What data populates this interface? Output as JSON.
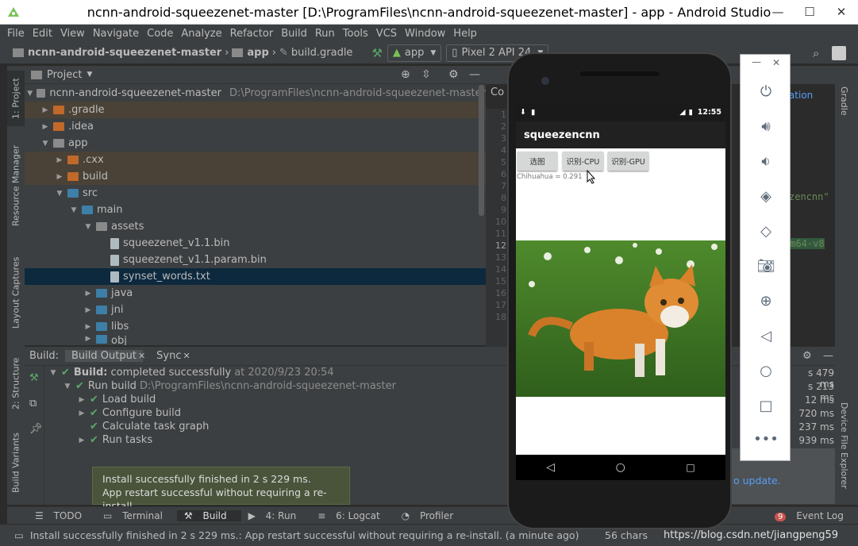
{
  "window": {
    "title": "ncnn-android-squeezenet-master [D:\\ProgramFiles\\ncnn-android-squeezenet-master] - app - Android Studio",
    "minimize": "—",
    "maximize": "☐",
    "close": "✕"
  },
  "menu": [
    "File",
    "Edit",
    "View",
    "Navigate",
    "Code",
    "Analyze",
    "Refactor",
    "Build",
    "Run",
    "Tools",
    "VCS",
    "Window",
    "Help"
  ],
  "nav": {
    "project": "ncnn-android-squeezenet-master",
    "module": "app",
    "file": "build.gradle",
    "run_config": "app",
    "device": "Pixel 2 API 24"
  },
  "left_tools": {
    "project": "1: Project",
    "resource": "Resource Manager",
    "layout": "Layout Captures",
    "structure": "2: Structure",
    "variants": "Build Variants"
  },
  "right_tools": {
    "gradle": "Gradle",
    "device_explorer": "Device File Explorer"
  },
  "project_panel": {
    "title": "Project",
    "tree": [
      {
        "label": "ncnn-android-squeezenet-master",
        "path": "D:\\ProgramFiles\\ncnn-android-squeezenet-master"
      },
      {
        "label": ".gradle"
      },
      {
        "label": ".idea"
      },
      {
        "label": "app"
      },
      {
        "label": ".cxx"
      },
      {
        "label": "build"
      },
      {
        "label": "src"
      },
      {
        "label": "main"
      },
      {
        "label": "assets"
      },
      {
        "label": "squeezenet_v1.1.bin"
      },
      {
        "label": "squeezenet_v1.1.param.bin"
      },
      {
        "label": "synset_words.txt"
      },
      {
        "label": "java"
      },
      {
        "label": "jni"
      },
      {
        "label": "libs"
      },
      {
        "label": "obj"
      }
    ]
  },
  "editor": {
    "tab": "Co",
    "line_numbers": [
      "1",
      "2",
      "3",
      "4",
      "5",
      "6",
      "7",
      "8",
      "9",
      "10",
      "11",
      "12",
      "13",
      "14",
      "15",
      "16",
      "17",
      "18"
    ],
    "snippet_1": "ication",
    "snippet_2": "zencnn\"",
    "snippet_3": "rm64-v8",
    "snippet_4": "o update."
  },
  "build_panel": {
    "label": "Build:",
    "tab_output": "Build Output",
    "tab_sync": "Sync",
    "rows": [
      {
        "bold": "Build:",
        "text": "completed successfully",
        "dim": "at 2020/9/23 20:54"
      },
      {
        "text": "Run build",
        "dim": "D:\\ProgramFiles\\ncnn-android-squeezenet-master"
      },
      {
        "text": "Load build"
      },
      {
        "text": "Configure build"
      },
      {
        "text": "Calculate task graph"
      },
      {
        "text": "Run tasks"
      }
    ],
    "times": [
      "s 479 ms",
      "s 213 ms",
      "12 ms",
      "720 ms",
      "237 ms",
      "939 ms"
    ]
  },
  "balloon": {
    "line1": "Install successfully finished in 2 s 229 ms.",
    "line2": "App restart successful without requiring a re-install."
  },
  "bottom_tabs": {
    "todo": "TODO",
    "terminal": "Terminal",
    "build": "Build",
    "run": "4: Run",
    "logcat": "6: Logcat",
    "profiler": "Profiler",
    "events_count": "9",
    "event_log": "Event Log"
  },
  "status": {
    "message": "Install successfully finished in 2 s 229 ms.: App restart successful without requiring a re-install. (a minute ago)",
    "chars": "56 chars",
    "watermark": "https://blog.csdn.net/jiangpeng59"
  },
  "phone": {
    "time": "12:55",
    "app_title": "squeezencnn",
    "btn_select": "选图",
    "btn_cpu": "识别-CPU",
    "btn_gpu": "识别-GPU",
    "result": "Chihuahua = 0.291"
  },
  "colors": {
    "accent": "#59a869",
    "ide_bg": "#3c3f41",
    "editor_bg": "#2b2b2b",
    "selection": "#0d293e"
  }
}
